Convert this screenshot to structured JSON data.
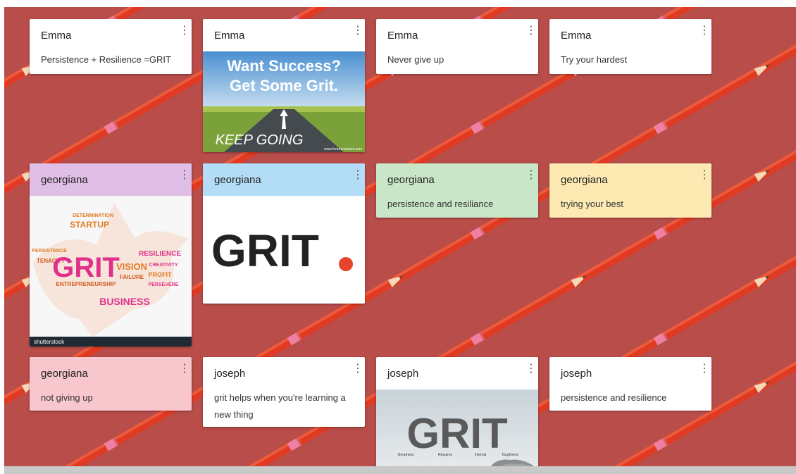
{
  "posts": [
    {
      "author": "Emma",
      "text": "Persistence + Resilience =GRIT",
      "menu": "⋮"
    },
    {
      "author": "Emma",
      "menu": "⋮",
      "image": {
        "headline_1": "Want Success?",
        "headline_2": "Get Some Grit.",
        "road_text": "KEEP GOING",
        "credit": "www.fortunecurrent.com"
      }
    },
    {
      "author": "Emma",
      "text": "Never give up",
      "menu": "⋮"
    },
    {
      "author": "Emma",
      "text": "Try your hardest",
      "menu": "⋮"
    },
    {
      "author": "georgiana",
      "menu": "⋮",
      "header_color": "#e0bfe6",
      "image": {
        "big_word": "GRIT",
        "words": [
          "STARTUP",
          "RESILIENCE",
          "VISION",
          "BUSINESS",
          "TENACITY",
          "PERSISTENCE",
          "CREATIVITY",
          "PROFIT",
          "ENTREPRENEURSHIP",
          "FAILURE",
          "PERSEVERE",
          "DETERMINATION"
        ],
        "brand": "shutterstock"
      }
    },
    {
      "author": "georgiana",
      "menu": "⋮",
      "header_color": "#b3ddf6",
      "image": {
        "logo_text": "GRIT",
        "dot_color": "#e8432d"
      }
    },
    {
      "author": "georgiana",
      "text": "persistence and resiliance",
      "menu": "⋮",
      "bg_color": "#c9e6c9"
    },
    {
      "author": "georgiana",
      "text": "trying your best",
      "menu": "⋮",
      "bg_color": "#fdeab3"
    },
    {
      "author": "georgiana",
      "text": "not giving up",
      "menu": "⋮",
      "bg_color": "#f8c6cd"
    },
    {
      "author": "joseph",
      "text": "grit helps when you're learning a new thing",
      "menu": "⋮"
    },
    {
      "author": "joseph",
      "menu": "⋮",
      "image": {
        "big_word": "GRIT",
        "labels": [
          "Greatness",
          "Requires",
          "Internal",
          "Toughness"
        ]
      }
    },
    {
      "author": "joseph",
      "text": "persistence and resilience",
      "menu": "⋮"
    }
  ],
  "colors": {
    "board_background": "#b84d4a",
    "pencil_body": "#e03a22",
    "pencil_eraser": "#f07fa4",
    "pencil_wood": "#f3d9b8"
  }
}
